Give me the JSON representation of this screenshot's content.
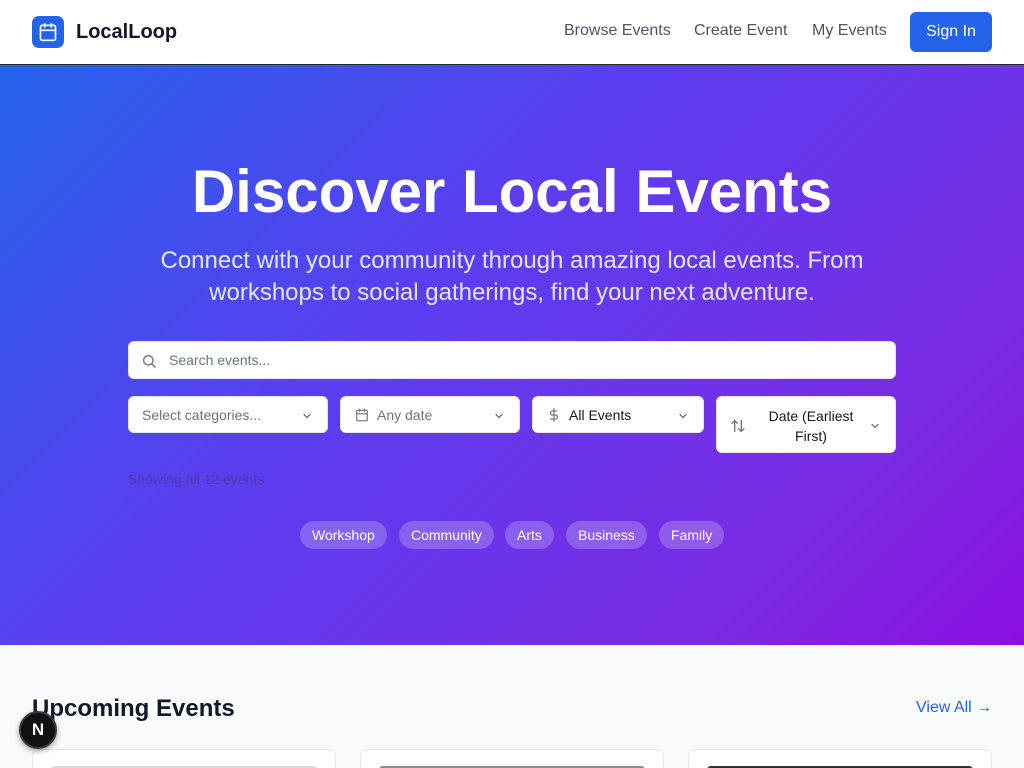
{
  "header": {
    "brand": "LocalLoop",
    "nav": [
      "Browse Events",
      "Create Event",
      "My Events"
    ],
    "sign_in": "Sign In"
  },
  "hero": {
    "title": "Discover Local Events",
    "subtitle": "Connect with your community through amazing local events. From workshops to social gatherings, find your next adventure.",
    "search_placeholder": "Search events...",
    "filters": {
      "categories": "Select categories...",
      "date": "Any date",
      "price": "All Events",
      "sort": "Date (Earliest First)"
    },
    "showing": "Showing all 12 events",
    "chips": [
      "Workshop",
      "Community",
      "Arts",
      "Business",
      "Family"
    ]
  },
  "upcoming": {
    "title": "Upcoming Events",
    "view_all": "View All →"
  },
  "badge": "N",
  "colors": {
    "primary": "#2563eb",
    "gradient_start": "#2563eb",
    "gradient_end": "#8b0fe0"
  }
}
